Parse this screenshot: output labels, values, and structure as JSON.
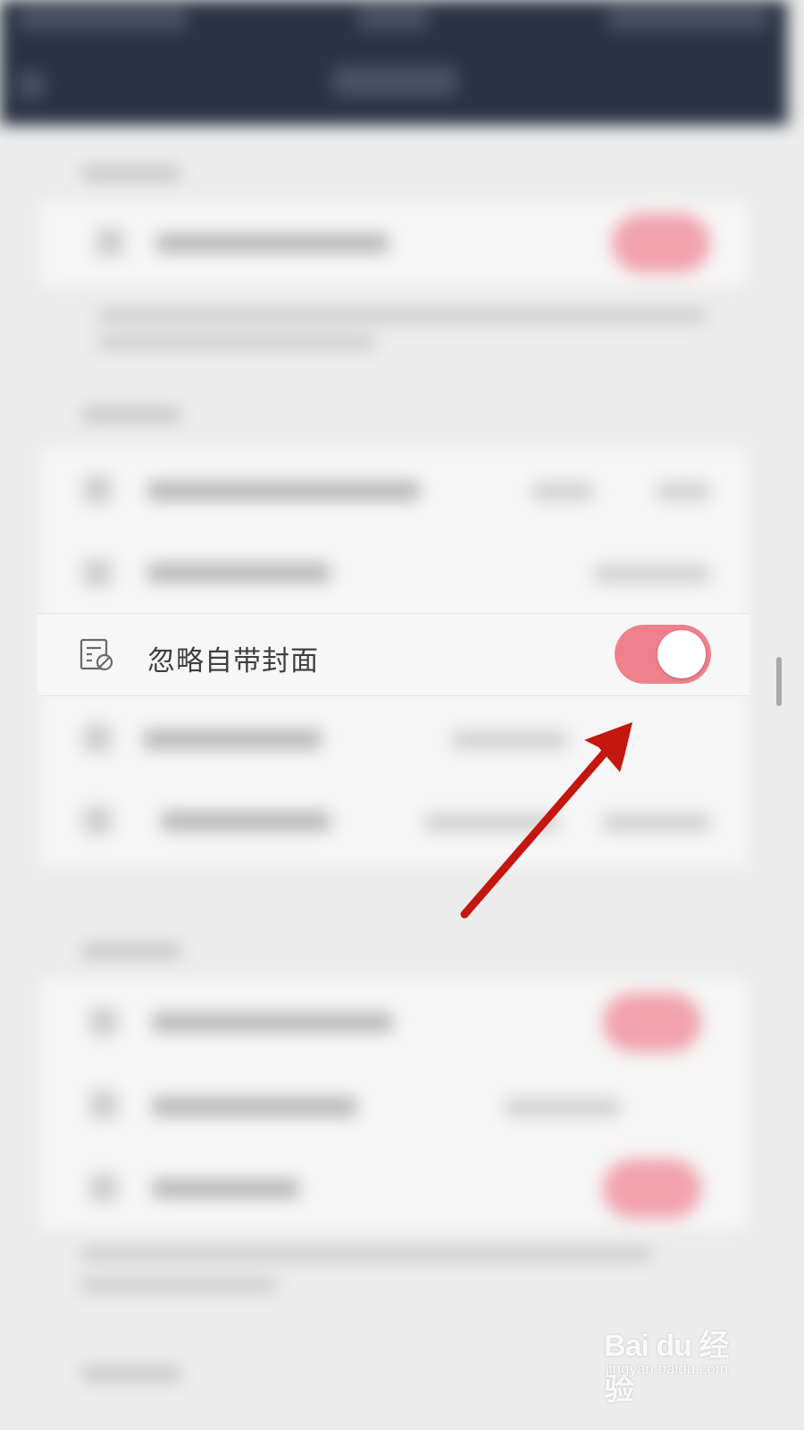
{
  "setting_row": {
    "label": "忽略自带封面",
    "icon": "cover-ignore-icon",
    "toggle_on": true
  },
  "colors": {
    "toggle_on": "#f0818c",
    "arrow": "#c4170f",
    "topbar": "#2a3344"
  },
  "watermark": {
    "logo": "Bai du 经验",
    "url": "jingyan.baidu.com"
  }
}
